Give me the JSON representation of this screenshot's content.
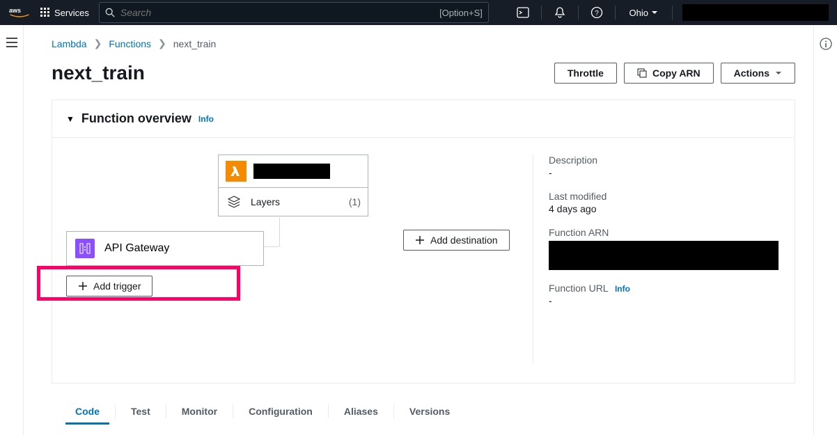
{
  "topnav": {
    "services": "Services",
    "search_placeholder": "Search",
    "shortcut": "[Option+S]",
    "region": "Ohio"
  },
  "breadcrumb": {
    "root": "Lambda",
    "functions": "Functions",
    "current": "next_train"
  },
  "page": {
    "title": "next_train"
  },
  "actions": {
    "throttle": "Throttle",
    "copy_arn": "Copy ARN",
    "actions": "Actions"
  },
  "overview": {
    "title": "Function overview",
    "info": "Info",
    "layers_label": "Layers",
    "layers_count": "(1)",
    "trigger_label": "API Gateway",
    "add_trigger": "Add trigger",
    "add_destination": "Add destination"
  },
  "side": {
    "desc_label": "Description",
    "desc_value": "-",
    "mod_label": "Last modified",
    "mod_value": "4 days ago",
    "arn_label": "Function ARN",
    "url_label": "Function URL",
    "url_info": "Info",
    "url_value": "-"
  },
  "tabs": {
    "code": "Code",
    "test": "Test",
    "monitor": "Monitor",
    "configuration": "Configuration",
    "aliases": "Aliases",
    "versions": "Versions"
  }
}
